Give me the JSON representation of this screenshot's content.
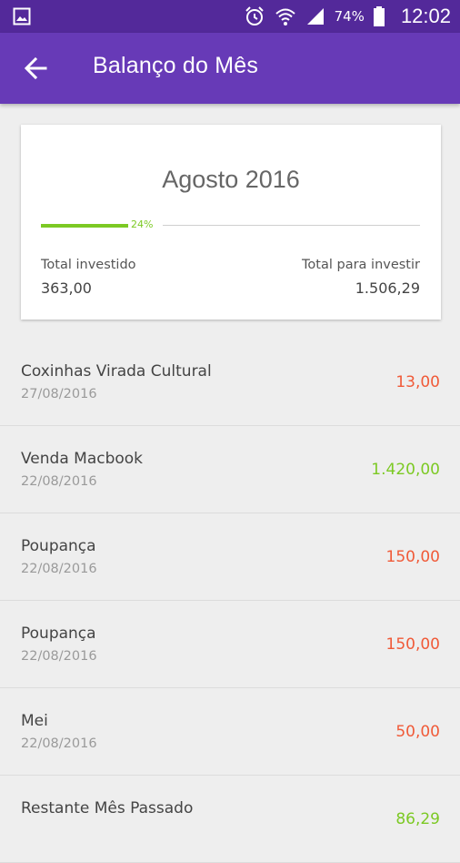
{
  "status_bar": {
    "battery": "74%",
    "time": "12:02"
  },
  "app_bar": {
    "title": "Balanço do Mês"
  },
  "summary": {
    "month": "Agosto 2016",
    "progress_percent": 24,
    "progress_label": "24%",
    "total_invested_label": "Total investido",
    "total_invested_value": "363,00",
    "total_to_invest_label": "Total para investir",
    "total_to_invest_value": "1.506,29"
  },
  "colors": {
    "status_bar": "#53299a",
    "app_bar": "#673ab7",
    "progress": "#7cc924",
    "expense": "#f05a38",
    "income": "#7cc924"
  },
  "transactions": [
    {
      "name": "Coxinhas Virada Cultural",
      "date": "27/08/2016",
      "amount": "13,00",
      "type": "expense"
    },
    {
      "name": "Venda Macbook",
      "date": "22/08/2016",
      "amount": "1.420,00",
      "type": "income"
    },
    {
      "name": "Poupança",
      "date": "22/08/2016",
      "amount": "150,00",
      "type": "expense"
    },
    {
      "name": "Poupança",
      "date": "22/08/2016",
      "amount": "150,00",
      "type": "expense"
    },
    {
      "name": "Mei",
      "date": "22/08/2016",
      "amount": "50,00",
      "type": "expense"
    },
    {
      "name": "Restante Mês Passado",
      "date": "",
      "amount": "86,29",
      "type": "income"
    }
  ]
}
